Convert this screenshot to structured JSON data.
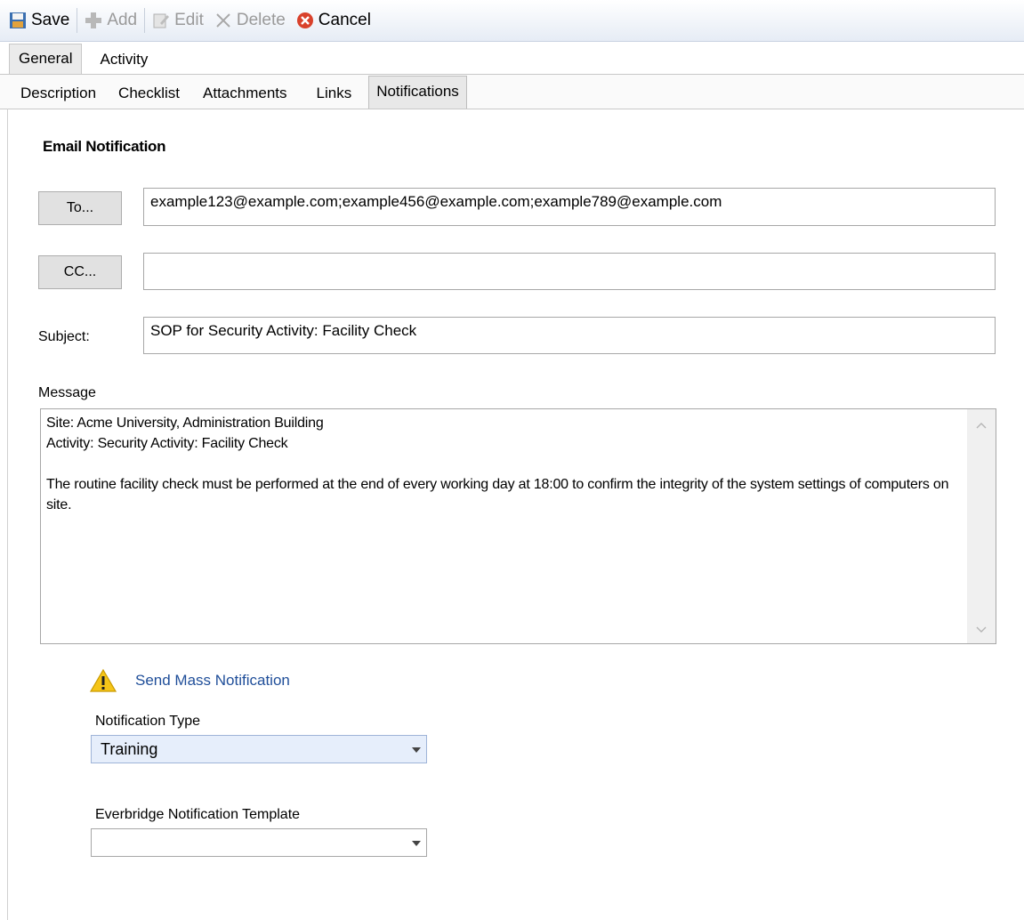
{
  "toolbar": {
    "save_label": "Save",
    "add_label": "Add",
    "edit_label": "Edit",
    "delete_label": "Delete",
    "cancel_label": "Cancel"
  },
  "main_tabs": [
    {
      "label": "General",
      "active": true
    },
    {
      "label": "Activity",
      "active": false
    }
  ],
  "sub_tabs": [
    {
      "label": "Description",
      "active": false
    },
    {
      "label": "Checklist",
      "active": false
    },
    {
      "label": "Attachments",
      "active": false
    },
    {
      "label": "Links",
      "active": false
    },
    {
      "label": "Notifications",
      "active": true
    }
  ],
  "email": {
    "section_title": "Email Notification",
    "to_button": "To...",
    "to_value": "example123@example.com;example456@example.com;example789@example.com",
    "cc_button": "CC...",
    "cc_value": "",
    "subject_label": "Subject:",
    "subject_value": "SOP for Security Activity: Facility Check",
    "message_label": "Message",
    "message_value": "Site: Acme University, Administration Building\nActivity: Security Activity: Facility Check\n\nThe routine facility check must be performed at the end of every working day at 18:00 to confirm the integrity of the system settings of computers on site."
  },
  "mass_notification": {
    "icon": "warning-icon",
    "link_label": "Send Mass Notification",
    "type_label": "Notification Type",
    "type_value": "Training",
    "template_label": "Everbridge Notification Template",
    "template_value": ""
  },
  "colors": {
    "link": "#1f4e99",
    "toolbar_bg": "#e6ecf5",
    "cancel_icon": "#d9412b",
    "warning_icon": "#f5c518"
  }
}
